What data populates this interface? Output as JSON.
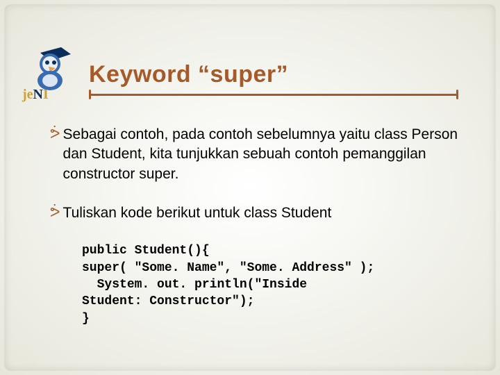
{
  "logo": {
    "name": "jeni-logo",
    "text": "jeNI"
  },
  "title": "Keyword “super”",
  "bullets": [
    {
      "text": "Sebagai contoh, pada contoh sebelumnya yaitu class Person dan Student, kita tunjukkan sebuah contoh pemanggilan constructor super."
    },
    {
      "text": "Tuliskan kode berikut untuk class Student"
    }
  ],
  "code": "public Student(){\nsuper( \"Some. Name\", \"Some. Address\" );\n  System. out. println(\"Inside\nStudent: Constructor\");\n}"
}
